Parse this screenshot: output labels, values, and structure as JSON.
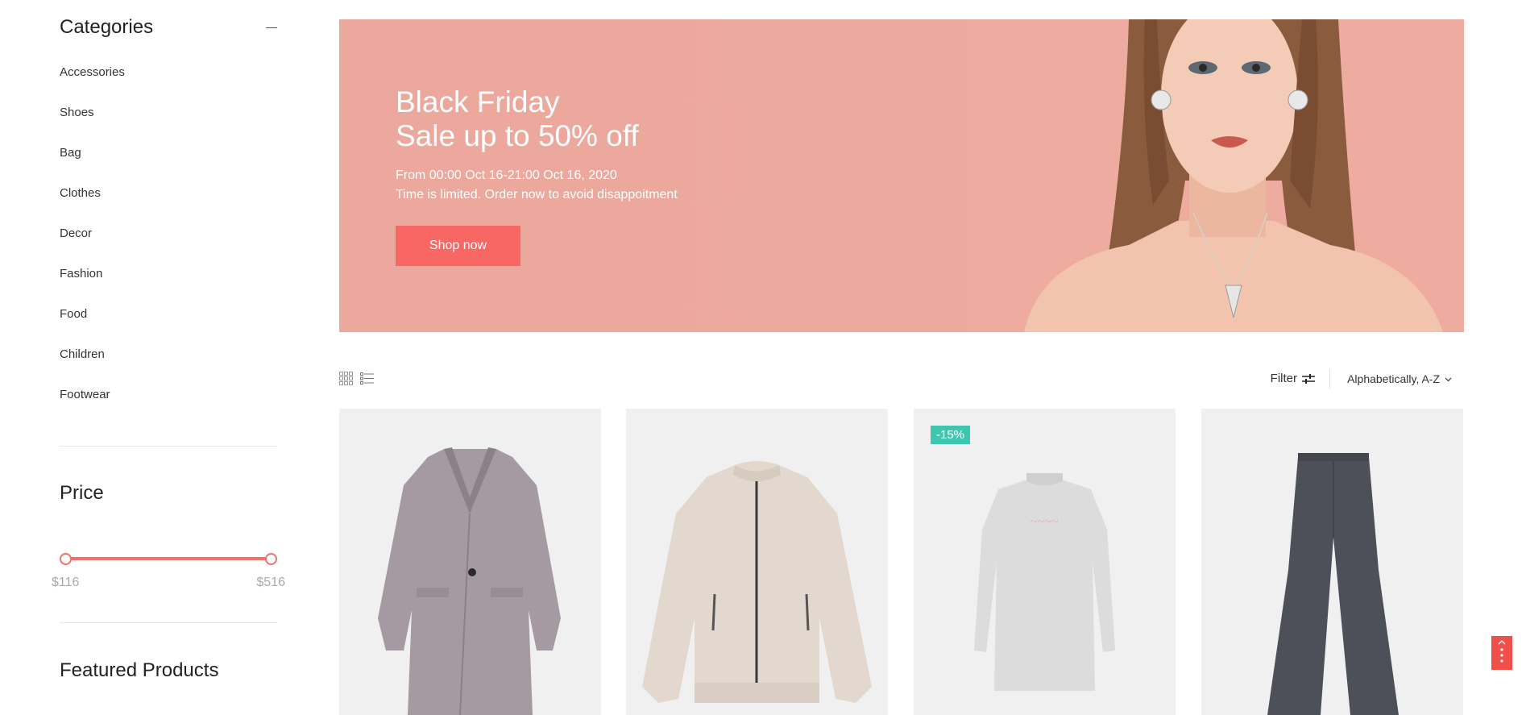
{
  "sidebar": {
    "categories_title": "Categories",
    "categories": [
      "Accessories",
      "Shoes",
      "Bag",
      "Clothes",
      "Decor",
      "Fashion",
      "Food",
      "Children",
      "Footwear"
    ],
    "price_title": "Price",
    "price_min": "$116",
    "price_max": "$516",
    "featured_title": "Featured Products"
  },
  "banner": {
    "title_line1": "Black Friday",
    "title_line2": "Sale up to 50% off",
    "sub_line1": "From 00:00 Oct 16-21:00 Oct 16, 2020",
    "sub_line2": "Time is limited. Order now to avoid disappoitment",
    "button": "Shop now"
  },
  "toolbar": {
    "filter_label": "Filter",
    "sort_label": "Alphabetically, A-Z"
  },
  "products": [
    {
      "item": "coat",
      "badge": ""
    },
    {
      "item": "bomber-jacket",
      "badge": ""
    },
    {
      "item": "dress",
      "badge": "-15%"
    },
    {
      "item": "trousers",
      "badge": ""
    }
  ],
  "colors": {
    "accent": "#f86764",
    "banner_bg": "#eca89c",
    "badge": "#3fc6b1",
    "slider": "#f0706b"
  },
  "icons": [
    "minus-icon",
    "grid-view-icon",
    "list-view-icon",
    "filter-sliders-icon",
    "chevron-down-icon",
    "dots-vertical-icon",
    "arrow-up-icon"
  ]
}
